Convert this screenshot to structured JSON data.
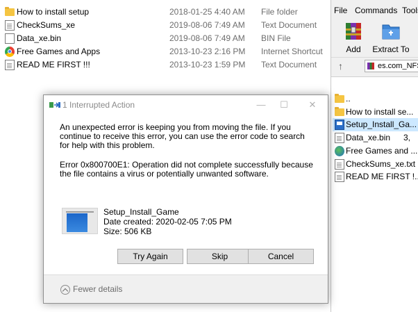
{
  "explorer": {
    "files": [
      {
        "name": "How to install setup",
        "date": "2018-01-25 4:40 AM",
        "type": "File folder",
        "icon": "folder-icon"
      },
      {
        "name": "CheckSums_xe",
        "date": "2019-08-06 7:49 AM",
        "type": "Text Document",
        "icon": "text-document-icon"
      },
      {
        "name": "Data_xe.bin",
        "date": "2019-08-06 7:49 AM",
        "type": "BIN File",
        "icon": "bin-file-icon"
      },
      {
        "name": "Free Games and Apps",
        "date": "2013-10-23 2:16 PM",
        "type": "Internet Shortcut",
        "icon": "internet-shortcut-icon"
      },
      {
        "name": "READ ME FIRST !!!",
        "date": "2013-10-23 1:59 PM",
        "type": "Text Document",
        "icon": "text-document-icon"
      }
    ]
  },
  "winrar": {
    "menu": [
      "File",
      "Commands",
      "Tools"
    ],
    "toolbar": {
      "add": "Add",
      "extract": "Extract To"
    },
    "address": "es.com_NFS",
    "files": [
      {
        "name": "..",
        "extra": "",
        "icon": "folder-icon"
      },
      {
        "name": "How to install se...",
        "extra": "",
        "icon": "folder-icon"
      },
      {
        "name": "Setup_Install_Ga...",
        "extra": "",
        "icon": "exe-icon"
      },
      {
        "name": "Data_xe.bin",
        "extra": "3,",
        "icon": "bin-file-icon"
      },
      {
        "name": "Free Games and ...",
        "extra": "",
        "icon": "globe-icon"
      },
      {
        "name": "CheckSums_xe.txt",
        "extra": "",
        "icon": "text-document-icon"
      },
      {
        "name": "READ ME FIRST !...",
        "extra": "",
        "icon": "text-document-icon"
      }
    ]
  },
  "dialog": {
    "title": "1 Interrupted Action",
    "message": "An unexpected error is keeping you from moving the file. If you continue to receive this error, you can use the error code to search for help with this problem.",
    "error": "Error 0x800700E1: Operation did not complete successfully because the file contains a virus or potentially unwanted software.",
    "file_name": "Setup_Install_Game",
    "date_created": "Date created: 2020-02-05 7:05 PM",
    "size": "Size: 506 KB",
    "buttons": {
      "try_again": "Try Again",
      "skip": "Skip",
      "cancel": "Cancel"
    },
    "fewer_details": "Fewer details"
  }
}
